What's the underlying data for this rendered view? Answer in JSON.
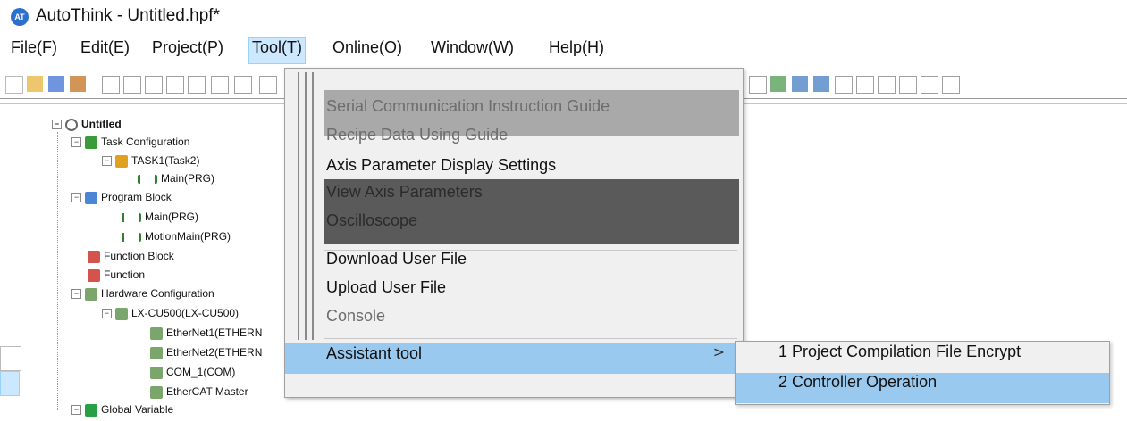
{
  "window": {
    "title": "AutoThink - Untitled.hpf*",
    "logo_text": "AT"
  },
  "menubar": {
    "items": [
      "File(F)",
      "Edit(E)",
      "Project(P)",
      "Tool(T)",
      "Online(O)",
      "Window(W)",
      "Help(H)"
    ],
    "active": "Tool(T)"
  },
  "tree": {
    "root": "Untitled",
    "task_configuration": "Task Configuration",
    "task1": "TASK1(Task2)",
    "task1_main": "Main(PRG)",
    "program_block": "Program Block",
    "program_main": "Main(PRG)",
    "program_motion_main": "MotionMain(PRG)",
    "function_block": "Function Block",
    "function": "Function",
    "hardware_configuration": "Hardware Configuration",
    "lx_cu500": "LX-CU500(LX-CU500)",
    "ethernet1": "EtherNet1(ETHERN",
    "ethernet2": "EtherNet2(ETHERN",
    "com1": "COM_1(COM)",
    "ethercat": "EtherCAT Master",
    "global_variable": "Global Variable"
  },
  "tool_menu": {
    "serial_guide": "Serial Communication Instruction Guide",
    "recipe_guide": "Recipe Data Using Guide",
    "axis_display_settings": "Axis Parameter Display Settings",
    "view_axis_parameters": "View Axis Parameters",
    "oscilloscope": "Oscilloscope",
    "download_user_file": "Download User File",
    "upload_user_file": "Upload User File",
    "console": "Console",
    "assistant_tool": "Assistant tool",
    "submenu_arrow": ">"
  },
  "assistant_submenu": {
    "item1": "1 Project Compilation File Encrypt",
    "item2": "2 Controller Operation"
  },
  "colors": {
    "highlight": "#99c9ef",
    "menu_active": "#cce8ff",
    "band_dark": "#5a5a5a",
    "band_light": "#a9a9a9"
  }
}
